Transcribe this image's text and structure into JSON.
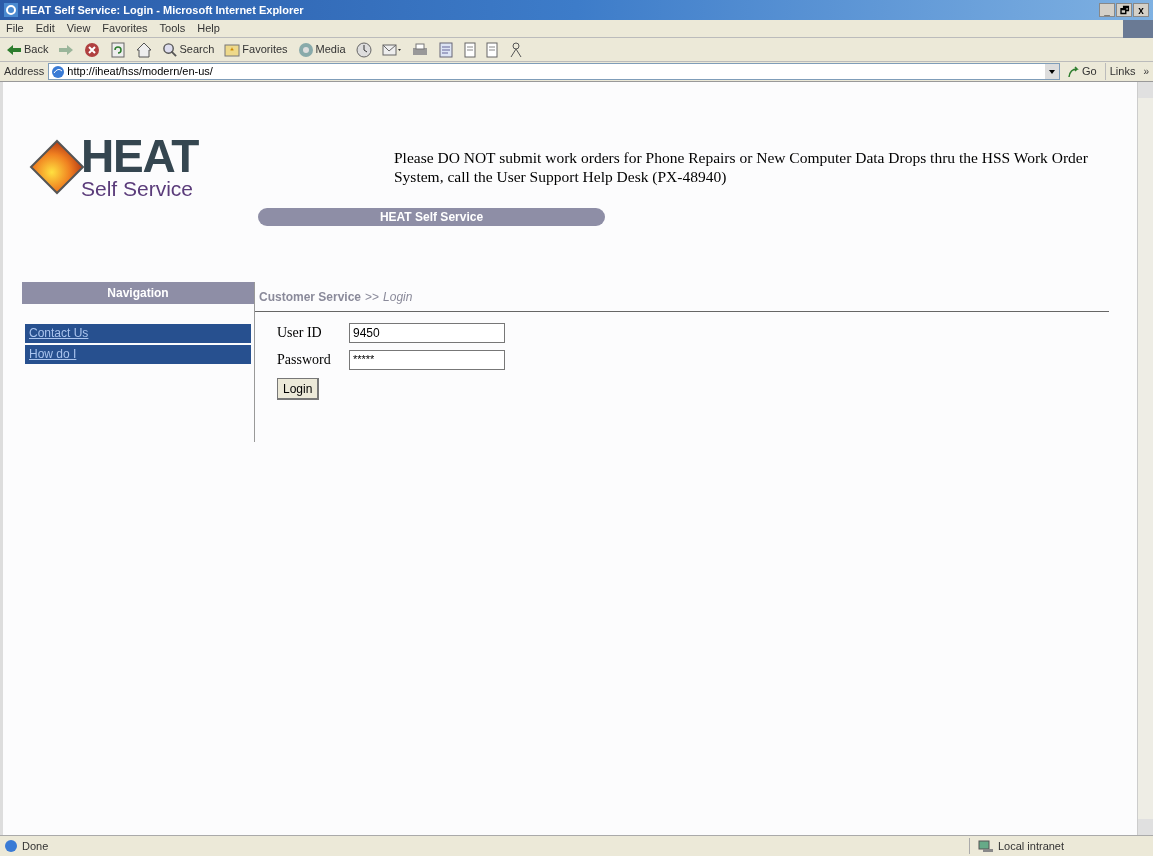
{
  "window": {
    "title": "HEAT Self Service: Login - Microsoft Internet Explorer",
    "controls": [
      "_",
      "🗗",
      "x"
    ]
  },
  "menu": [
    "File",
    "Edit",
    "View",
    "Favorites",
    "Tools",
    "Help"
  ],
  "toolbar": [
    {
      "kind": "labeled",
      "label": "Back"
    },
    {
      "kind": "icon"
    },
    {
      "kind": "icon"
    },
    {
      "kind": "icon"
    },
    {
      "kind": "icon"
    },
    {
      "kind": "labeled",
      "label": "Search"
    },
    {
      "kind": "labeled",
      "label": "Favorites"
    },
    {
      "kind": "labeled",
      "label": "Media"
    },
    {
      "kind": "icon"
    },
    {
      "kind": "icon"
    },
    {
      "kind": "icon"
    },
    {
      "kind": "icon"
    },
    {
      "kind": "icon"
    },
    {
      "kind": "icon"
    },
    {
      "kind": "icon"
    }
  ],
  "address": {
    "label": "Address",
    "url": "http://iheat/hss/modern/en-us/",
    "go": "Go",
    "links": "Links",
    "more": "»"
  },
  "page": {
    "logo": {
      "word": "HEAT",
      "tagline": "Self Service"
    },
    "notice": "Please DO NOT submit work orders for Phone Repairs or New Computer Data Drops thru the HSS Work Order System, call the User Support Help Desk (PX-48940)",
    "banner": "HEAT Self Service",
    "navigation": {
      "title": "Navigation",
      "items": [
        "Contact Us",
        "How do I"
      ]
    },
    "breadcrumb": {
      "section": "Customer Service",
      "separator": ">>",
      "current": "Login"
    },
    "form": {
      "user_id": {
        "label": "User ID",
        "value": "9450"
      },
      "password": {
        "label": "Password",
        "value": "*****"
      },
      "submit": "Login"
    }
  },
  "status_bar": {
    "text": "Done",
    "zone": "Local intranet"
  }
}
